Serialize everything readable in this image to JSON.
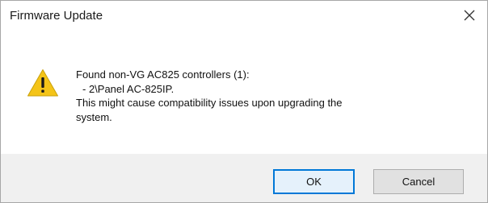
{
  "window": {
    "title": "Firmware Update",
    "close_icon": "close-icon"
  },
  "message": {
    "icon": "warning-icon",
    "line1": "Found non-VG AC825 controllers (1):",
    "line2": "- 2\\Panel AC-825IP.",
    "line3": "This might cause compatibility issues upon upgrading the",
    "line4": "system."
  },
  "buttons": {
    "ok_label": "OK",
    "cancel_label": "Cancel"
  },
  "colors": {
    "warning_fill": "#f4c418",
    "focus_border": "#0078d7",
    "footer_bg": "#f0f0f0"
  }
}
